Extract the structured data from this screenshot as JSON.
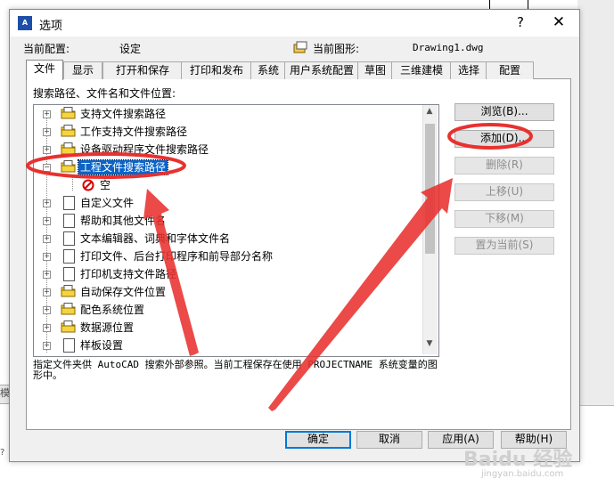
{
  "dialog": {
    "title": "选项",
    "help_glyph": "?",
    "close_glyph": "✕",
    "current_config_label": "当前配置:",
    "current_config_value": "设定",
    "current_drawing_label": "当前图形:",
    "current_drawing_value": "Drawing1.dwg"
  },
  "tabs": [
    "文件",
    "显示",
    "打开和保存",
    "打印和发布",
    "系统",
    "用户系统配置",
    "草图",
    "三维建模",
    "选择",
    "配置"
  ],
  "active_tab": "文件",
  "section_label": "搜索路径、文件名和文件位置:",
  "tree": {
    "items": [
      {
        "label": "支持文件搜索路径",
        "expander": "+",
        "icon": "folder-icon"
      },
      {
        "label": "工作支持文件搜索路径",
        "expander": "+",
        "icon": "folder-icon"
      },
      {
        "label": "设备驱动程序文件搜索路径",
        "expander": "+",
        "icon": "folder-icon"
      },
      {
        "label": "工程文件搜索路径",
        "expander": "−",
        "icon": "folder-icon",
        "selected": true
      },
      {
        "label": "空",
        "icon": "empty-icon",
        "child": true
      },
      {
        "label": "自定义文件",
        "expander": "+",
        "icon": "document-icon"
      },
      {
        "label": "帮助和其他文件名",
        "expander": "+",
        "icon": "document-icon"
      },
      {
        "label": "文本编辑器、词典和字体文件名",
        "expander": "+",
        "icon": "document-icon"
      },
      {
        "label": "打印文件、后台打印程序和前导部分名称",
        "expander": "+",
        "icon": "document-icon"
      },
      {
        "label": "打印机支持文件路径",
        "expander": "+",
        "icon": "document-icon"
      },
      {
        "label": "自动保存文件位置",
        "expander": "+",
        "icon": "folder-icon"
      },
      {
        "label": "配色系统位置",
        "expander": "+",
        "icon": "folder-icon"
      },
      {
        "label": "数据源位置",
        "expander": "+",
        "icon": "folder-icon"
      },
      {
        "label": "样板设置",
        "expander": "+",
        "icon": "document-icon"
      }
    ]
  },
  "side_buttons": {
    "browse": "浏览(B)...",
    "add": "添加(D)...",
    "remove": "删除(R)",
    "move_up": "上移(U)",
    "move_down": "下移(M)",
    "set_current": "置为当前(S)"
  },
  "description": "指定文件夹供 AutoCAD 搜索外部参照。当前工程保存在使用 PROJECTNAME 系统变量的图形中。",
  "bottom_buttons": {
    "ok": "确定",
    "cancel": "取消",
    "apply": "应用(A)",
    "help": "帮助(H)"
  },
  "background": {
    "left_strip_text": "模",
    "left_small_text": "?"
  },
  "watermark": {
    "brand": "Baidu 经验",
    "url": "jingyan.baidu.com"
  },
  "colors": {
    "selection": "#0a64c8",
    "annotation_red": "#e8312f",
    "default_button_border": "#0078d7"
  }
}
